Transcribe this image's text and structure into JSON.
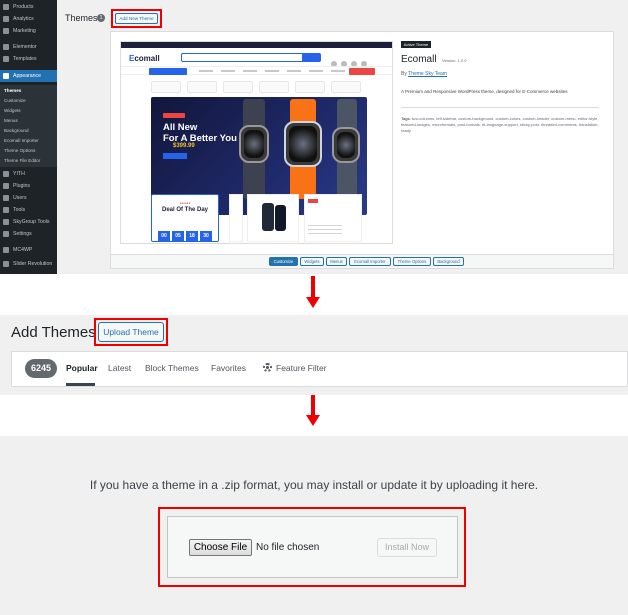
{
  "panel1": {
    "sidebar": {
      "items": [
        {
          "label": "Products",
          "icon": "products-icon"
        },
        {
          "label": "Analytics",
          "icon": "analytics-icon"
        },
        {
          "label": "Marketing",
          "icon": "marketing-icon"
        },
        {
          "label": "Elementor",
          "icon": "elementor-icon"
        },
        {
          "label": "Templates",
          "icon": "templates-icon"
        },
        {
          "label": "Appearance",
          "icon": "appearance-icon",
          "active": true
        },
        {
          "label": "YITH",
          "icon": "yith-icon"
        },
        {
          "label": "Plugins",
          "icon": "plugins-icon"
        },
        {
          "label": "Users",
          "icon": "users-icon"
        },
        {
          "label": "Tools",
          "icon": "tools-icon"
        },
        {
          "label": "SkyGroup Tools",
          "icon": "skygroup-icon"
        },
        {
          "label": "Settings",
          "icon": "settings-icon"
        },
        {
          "label": "MC4WP",
          "icon": "mc4wp-icon"
        },
        {
          "label": "Slider Revolution",
          "icon": "slider-icon"
        }
      ],
      "submenu": [
        "Themes",
        "Customize",
        "Widgets",
        "Menus",
        "Background",
        "Ecomall Importer",
        "Theme Options",
        "Theme File Editor"
      ]
    },
    "title": "Themes",
    "theme_count": "1",
    "add_new_label": "Add New Theme",
    "preview": {
      "logo_prefix": "E",
      "logo_rest": "comall",
      "hero_headline": "All New\nFor A Better You",
      "hero_price": "$399.99",
      "deal_title": "Deal Of The Day",
      "timer": [
        "00",
        "05",
        "18",
        "30"
      ]
    },
    "active_badge": "Active Theme",
    "theme_name": "Ecomall",
    "theme_version": "Version: 1.0.0",
    "author_prefix": "By",
    "author_name": "Theme Sky Team",
    "description": "A Premium and Responsive WordPress theme, designed for E-Commerce websites",
    "tags_label": "Tags:",
    "tags": "two-columns, left-sidebar, custom-background, custom-colors, custom-header, custom-menu, editor-style, featured-images, microformats, post-formats, rtl-language-support, sticky-post, threaded-comments, translation-ready",
    "actions": [
      "Customize",
      "Widgets",
      "Menus",
      "Ecomall Importer",
      "Theme Options",
      "Background"
    ]
  },
  "panel2": {
    "title": "Add Themes",
    "upload_label": "Upload Theme",
    "count": "6245",
    "tabs": [
      "Popular",
      "Latest",
      "Block Themes",
      "Favorites"
    ],
    "feature_filter": "Feature Filter"
  },
  "panel3": {
    "description": "If you have a theme in a .zip format, you may install or update it by uploading it here.",
    "choose_file": "Choose File",
    "no_file": "No file chosen",
    "install": "Install Now"
  },
  "colors": {
    "highlight": "#e00000",
    "wp_blue": "#2271b1",
    "sidebar": "#1d2327"
  }
}
